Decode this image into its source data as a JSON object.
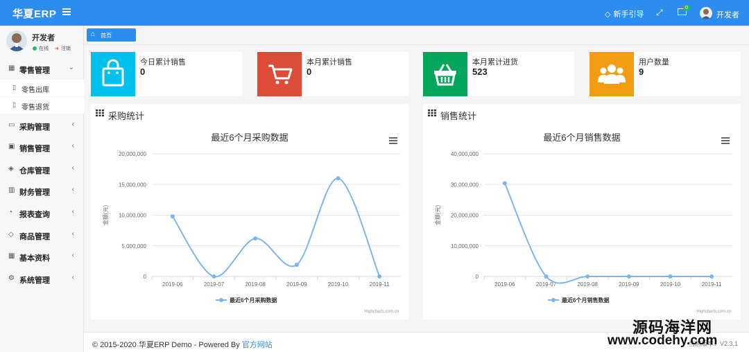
{
  "header": {
    "brand": "华夏ERP",
    "guide_label": "新手引导",
    "mail_badge": "0",
    "user_name": "开发者"
  },
  "sidebar": {
    "user_name": "开发者",
    "status_online": "在线",
    "status_logout": "注销",
    "menu": [
      {
        "label": "零售管理",
        "icon": "calendar-icon"
      },
      {
        "label": "采购管理",
        "icon": "monitor-icon"
      },
      {
        "label": "销售管理",
        "icon": "briefcase-icon"
      },
      {
        "label": "仓库管理",
        "icon": "layers-icon"
      },
      {
        "label": "财务管理",
        "icon": "book-icon"
      },
      {
        "label": "报表查询",
        "icon": "pie-icon"
      },
      {
        "label": "商品管理",
        "icon": "stack-icon"
      },
      {
        "label": "基本资料",
        "icon": "grid-icon"
      },
      {
        "label": "系统管理",
        "icon": "gear-icon"
      }
    ],
    "retail_sub": [
      {
        "label": "零售出库"
      },
      {
        "label": "零售退货"
      }
    ]
  },
  "tabs": {
    "home": "首页"
  },
  "cards": [
    {
      "label": "今日累计销售",
      "value": "0",
      "color": "#00c0ef",
      "icon": "shopping-bag-icon"
    },
    {
      "label": "本月累计销售",
      "value": "0",
      "color": "#dd4b39",
      "icon": "cart-icon"
    },
    {
      "label": "本月累计进货",
      "value": "523",
      "color": "#00a65a",
      "icon": "basket-icon"
    },
    {
      "label": "用户数量",
      "value": "9",
      "color": "#f39c12",
      "icon": "users-icon"
    }
  ],
  "panels": {
    "purchase": {
      "title": "采购统计"
    },
    "sales": {
      "title": "销售统计"
    }
  },
  "chart_data": [
    {
      "type": "line",
      "title": "最近6个月采购数据",
      "ylabel": "金额(元)",
      "categories": [
        "2019-06",
        "2019-07",
        "2019-08",
        "2019-09",
        "2019-10",
        "2019-11"
      ],
      "yticks": [
        "0",
        "5,000,000",
        "10,000,000",
        "15,000,000",
        "20,000,000"
      ],
      "ylim": [
        0,
        20000000
      ],
      "series": [
        {
          "name": "最近6个月采购数据",
          "values": [
            9800000,
            0,
            6200000,
            1900000,
            16000000,
            0
          ]
        }
      ],
      "credits": "Highcharts.com.cn",
      "legend": "bottom-center",
      "grid": true,
      "color": "#7cb5ec"
    },
    {
      "type": "line",
      "title": "最近6个月销售数据",
      "ylabel": "金额(元)",
      "categories": [
        "2019-06",
        "2019-07",
        "2019-08",
        "2019-09",
        "2019-10",
        "2019-11"
      ],
      "yticks": [
        "0",
        "10,000,000",
        "20,000,000",
        "30,000,000",
        "40,000,000"
      ],
      "ylim": [
        0,
        40000000
      ],
      "series": [
        {
          "name": "最近6个月销售数据",
          "values": [
            30400000,
            0,
            0,
            0,
            0,
            0
          ]
        }
      ],
      "credits": "Highcharts.com.cn",
      "legend": "bottom-center",
      "grid": true,
      "color": "#7cb5ec"
    }
  ],
  "footer": {
    "text": "© 2015-2020 华夏ERP Demo - Powered By",
    "link": "官方网站",
    "right": "当前版本：V2.3.1"
  },
  "watermark": {
    "line1": "源码海洋网",
    "line2": "www.codehy.com"
  }
}
